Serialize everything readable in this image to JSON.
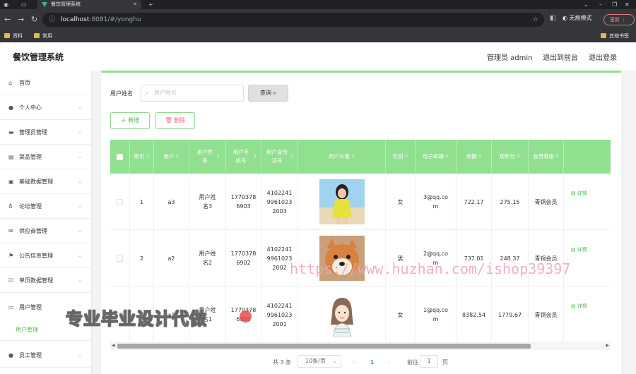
{
  "browser": {
    "tab_title": "餐饮管理系统",
    "url_host": "localhost",
    "url_path": ":8081/#/yonghu",
    "incognito_label": "无痕模式",
    "update_label": "更新",
    "bookmarks": [
      "资料",
      "常用"
    ],
    "other_bookmarks": "其他书签"
  },
  "app": {
    "title": "餐饮管理系统",
    "header_links": [
      "管理员 admin",
      "退出到前台",
      "退出登录"
    ]
  },
  "sidebar": {
    "items": [
      {
        "label": "首页",
        "icon": "home-icon"
      },
      {
        "label": "个人中心",
        "icon": "user-icon"
      },
      {
        "label": "管理员管理",
        "icon": "chat-icon"
      },
      {
        "label": "菜品管理",
        "icon": "dish-icon"
      },
      {
        "label": "基础数据管理",
        "icon": "data-icon"
      },
      {
        "label": "论坛管理",
        "icon": "mic-icon"
      },
      {
        "label": "供应商管理",
        "icon": "mail-icon"
      },
      {
        "label": "公告信息管理",
        "icon": "flag-icon"
      },
      {
        "label": "单页数据管理",
        "icon": "doc-icon"
      },
      {
        "label": "用户管理",
        "icon": "monitor-icon"
      },
      {
        "label": "员工管理",
        "icon": "user-icon"
      }
    ],
    "active_sub": "用户管理"
  },
  "search": {
    "label": "用户姓名",
    "placeholder": "用户姓名",
    "button": "查询"
  },
  "actions": {
    "add": "新增",
    "delete": "删除"
  },
  "table": {
    "columns": [
      "索引",
      "账户",
      "用户姓名",
      "用户手机号",
      "用户身份证号",
      "用户头像",
      "性别",
      "电子邮箱",
      "余额",
      "现积分",
      "会员等级"
    ],
    "detail_label": "详情",
    "rows": [
      {
        "index": "1",
        "account": "a3",
        "name": "用户姓名3",
        "phone": "17703786903",
        "idcard": "410224199610232003",
        "avatar": "girl-photo",
        "gender": "女",
        "email": "3@qq.com",
        "balance": "722.17",
        "points": "275.15",
        "level": "青铜会员"
      },
      {
        "index": "2",
        "account": "a2",
        "name": "用户姓名2",
        "phone": "17703786902",
        "idcard": "410224199610232002",
        "avatar": "dog-photo",
        "gender": "男",
        "email": "2@qq.com",
        "balance": "737.01",
        "points": "248.37",
        "level": "青铜会员"
      },
      {
        "index": "3",
        "account": "a1",
        "name": "用户姓名1",
        "phone": "17703786901",
        "idcard": "410224199610232001",
        "avatar": "cartoon-girl",
        "gender": "女",
        "email": "1@qq.com",
        "balance": "8382.54",
        "points": "1779.67",
        "level": "青铜会员"
      }
    ]
  },
  "pagination": {
    "total": "共 3 条",
    "page_size": "10条/页",
    "current": "1",
    "goto_label": "前往",
    "goto_value": "1",
    "page_unit": "页"
  },
  "overlay": {
    "watermark": "https://www.huzhan.com/ishop39397",
    "caption": "专业毕业设计代做"
  },
  "colors": {
    "accent": "#90e090",
    "active_text": "#4cb84c"
  }
}
